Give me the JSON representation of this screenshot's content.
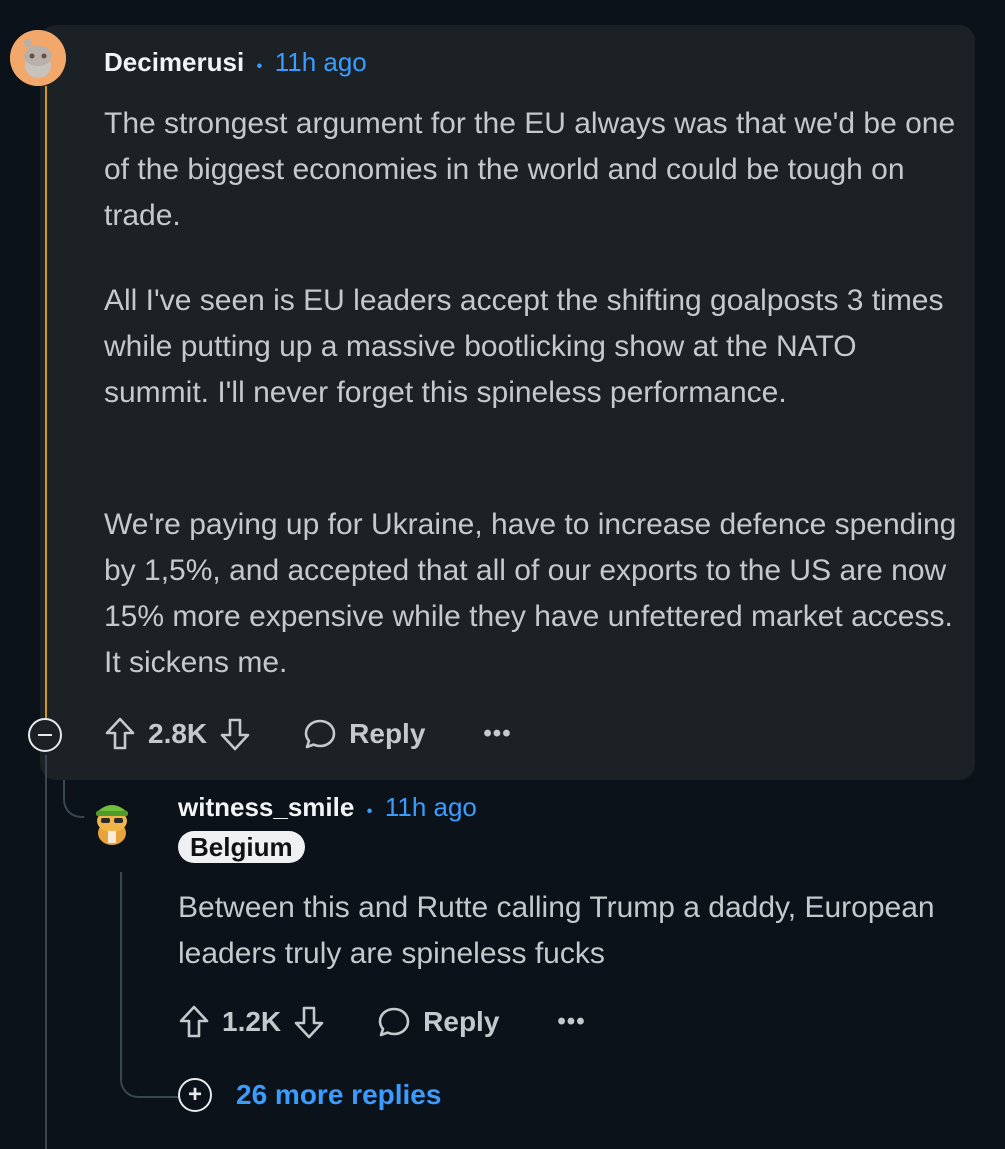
{
  "comment": {
    "author": "Decimerusi",
    "separator": "•",
    "time": "11h ago",
    "paragraphs": [
      "The strongest argument for the EU always was that we'd be one of the biggest economies in the world and could be tough on trade.",
      "All I've seen is EU leaders accept the shifting goalposts 3 times while putting up a massive bootlicking show at the NATO summit. I'll never forget this spineless performance.",
      "We're paying up for Ukraine, have to increase defence spending by 1,5%, and accepted that all of our exports to the US are now 15% more expensive while they have unfettered market access. It sickens me."
    ],
    "score": "2.8K",
    "reply_label": "Reply",
    "more_label": "•••"
  },
  "reply": {
    "author": "witness_smile",
    "separator": "•",
    "time": "11h ago",
    "flair": "Belgium",
    "text": "Between this and Rutte calling Trump a daddy, European leaders truly are spineless fucks",
    "score": "1.2K",
    "reply_label": "Reply",
    "more_label": "•••"
  },
  "more_replies": {
    "icon": "plus-circle-icon",
    "label": "26 more replies"
  },
  "colors": {
    "background": "#0b1219",
    "card": "#1b2125",
    "thread_highlight": "#d19b18",
    "link_blue": "#3b9cff"
  }
}
